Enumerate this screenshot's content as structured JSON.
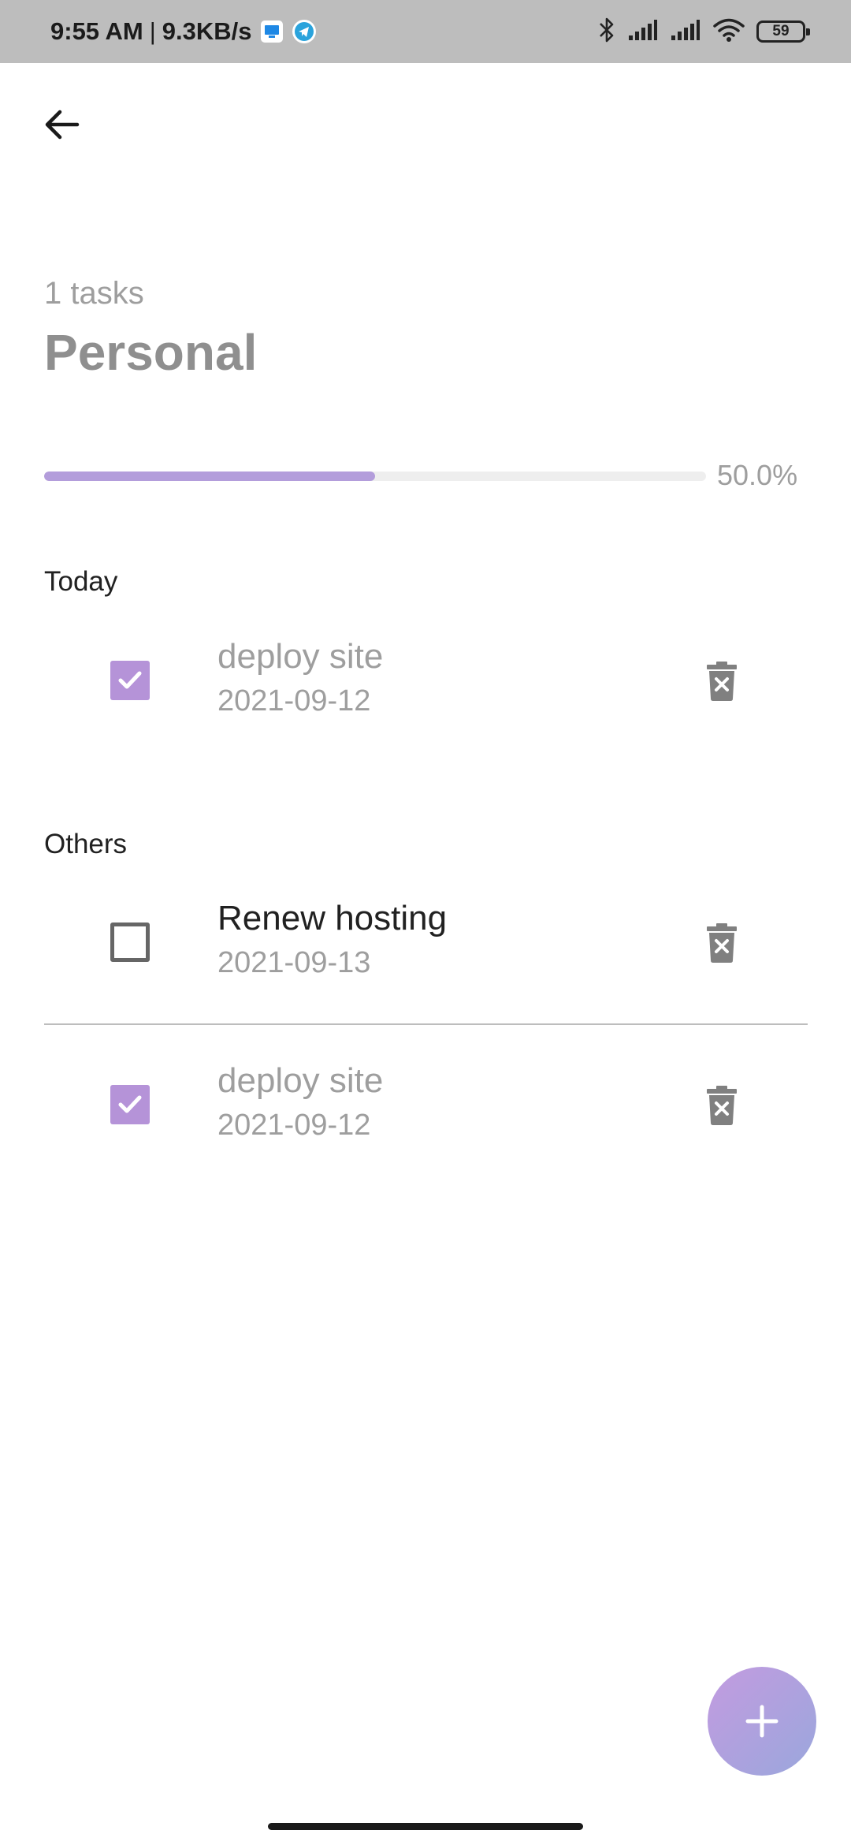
{
  "status_bar": {
    "time": "9:55 AM",
    "separator": "|",
    "speed": "9.3KB/s",
    "battery": "59",
    "icons": [
      "app-notification-icon",
      "telegram-icon",
      "bluetooth-icon",
      "signal-icon",
      "signal-icon",
      "wifi-icon",
      "battery-icon"
    ]
  },
  "header": {
    "back_icon": "arrow-left-icon",
    "task_count": "1 tasks",
    "title": "Personal"
  },
  "progress": {
    "label": "50.0%",
    "value": 0.5,
    "color": "#b39ddb"
  },
  "sections": {
    "today_label": "Today",
    "others_label": "Others"
  },
  "tasks": [
    {
      "title": "deploy site",
      "date": "2021-09-12",
      "done": true
    },
    {
      "title": "Renew hosting",
      "date": "2021-09-13",
      "done": false
    },
    {
      "title": "deploy site",
      "date": "2021-09-12",
      "done": true
    }
  ],
  "fab": {
    "icon": "plus-icon"
  },
  "colors": {
    "accent": "#b593d8",
    "fab_gradient_start": "#c39be0",
    "fab_gradient_end": "#9aa7dc",
    "muted_text": "#9e9e9e",
    "status_bar_bg": "#bdbdbd"
  }
}
